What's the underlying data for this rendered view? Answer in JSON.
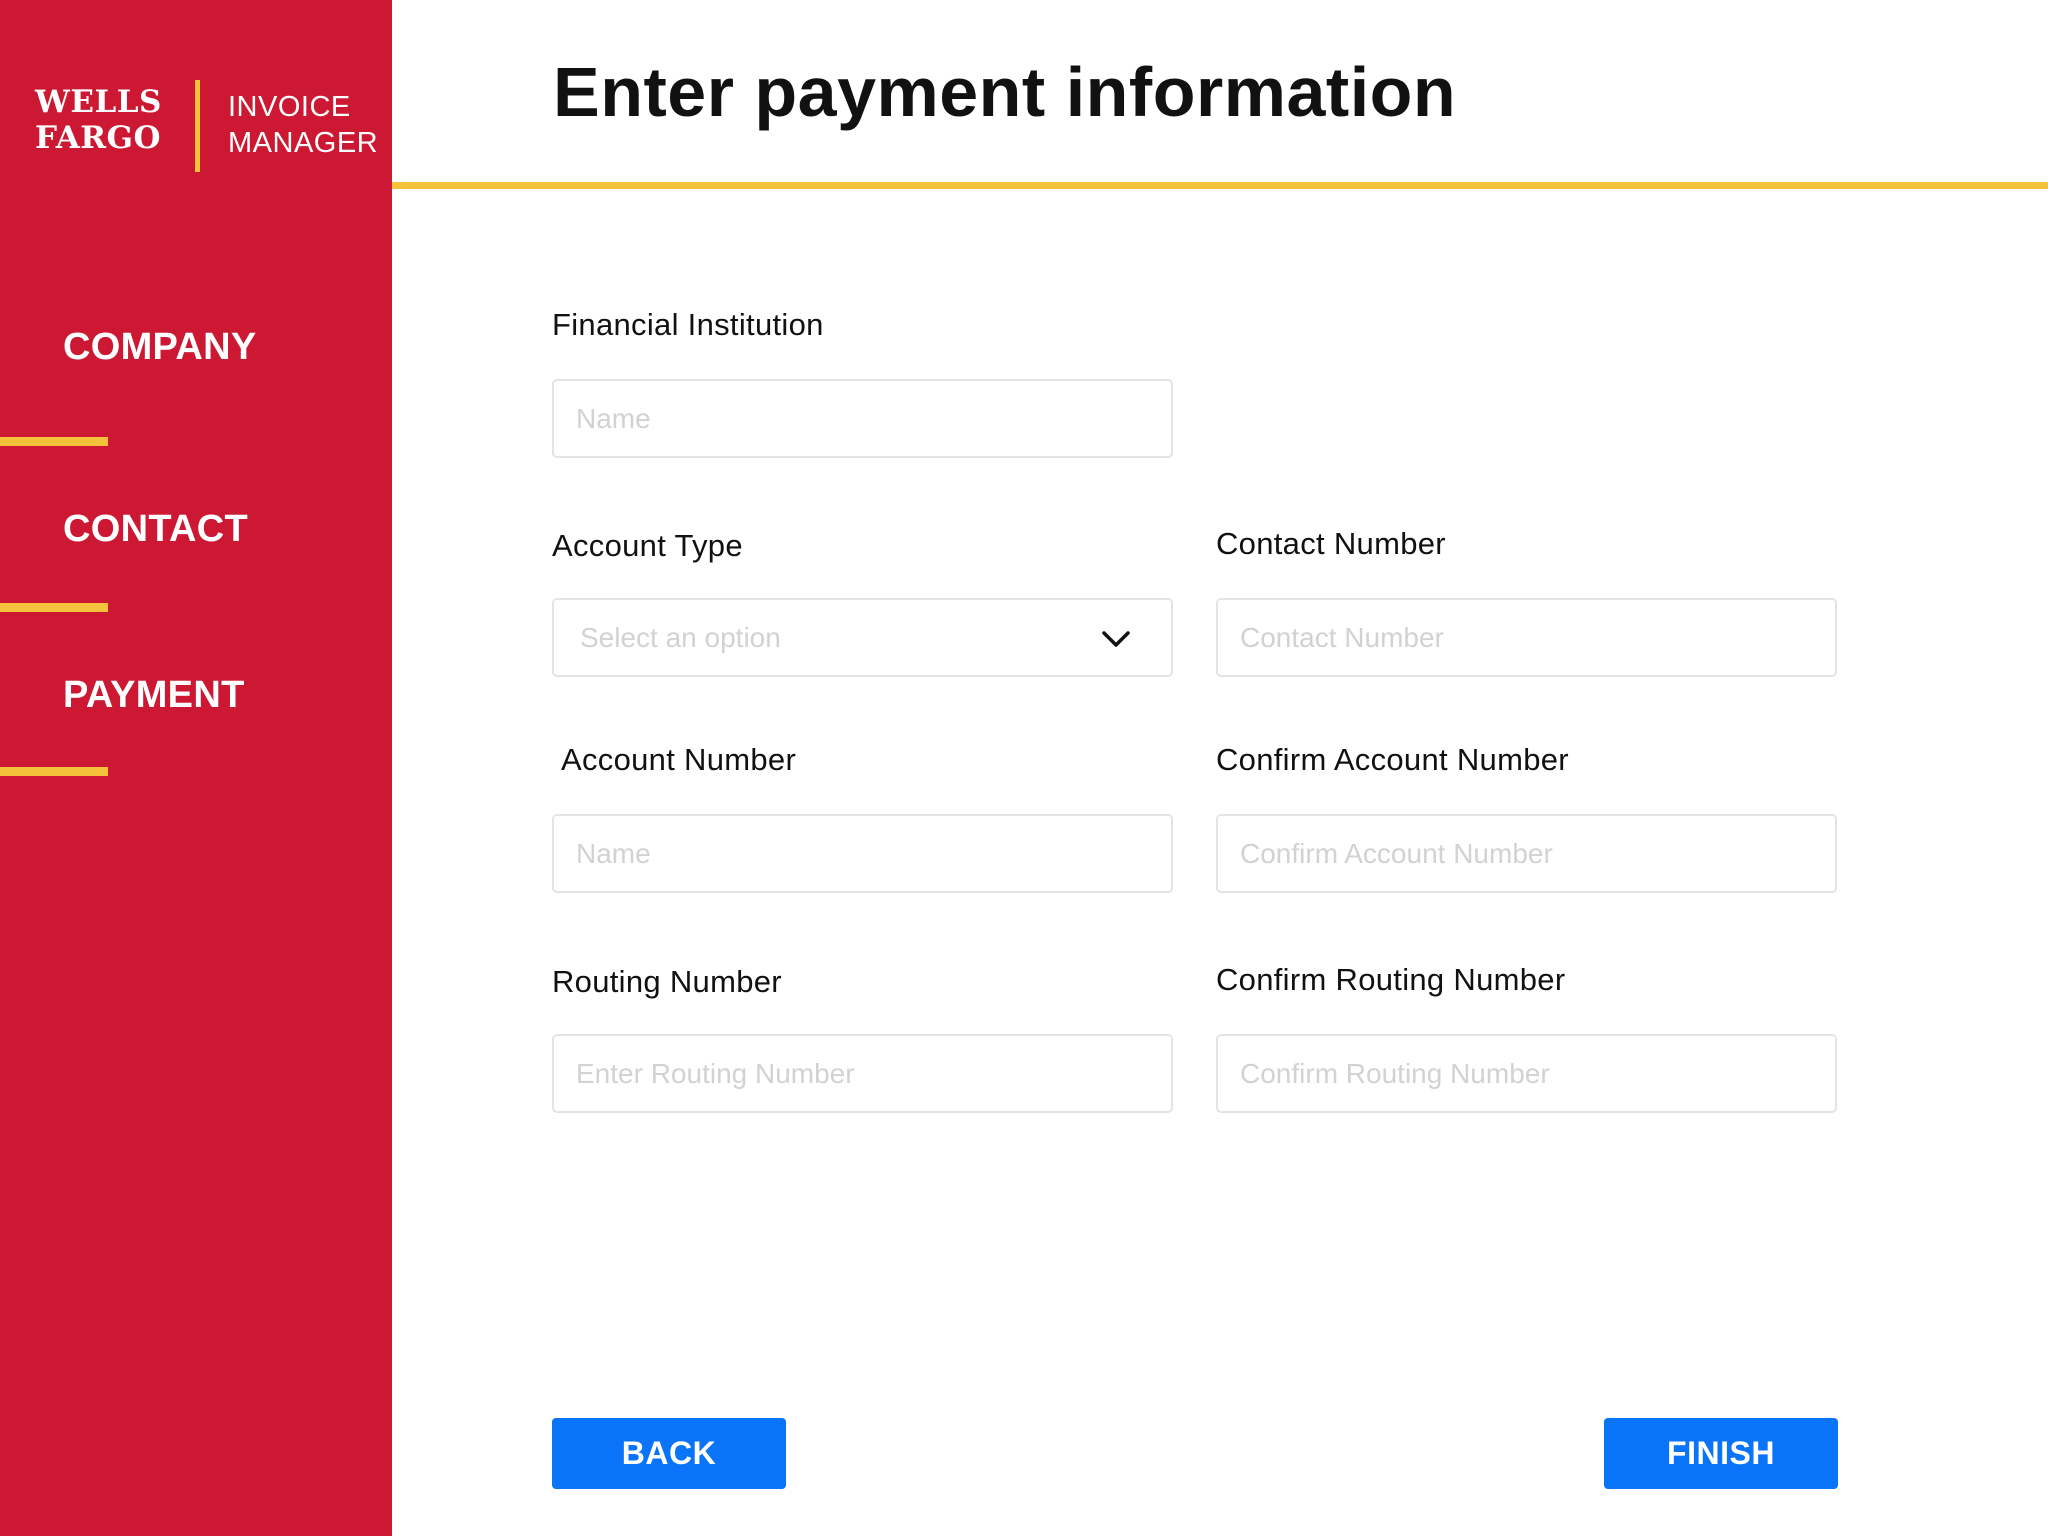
{
  "brand": {
    "line1": "WELLS",
    "line2": "FARGO",
    "product_line1": "INVOICE",
    "product_line2": "MANAGER"
  },
  "sidebar": {
    "items": [
      {
        "label": "COMPANY"
      },
      {
        "label": "CONTACT"
      },
      {
        "label": "PAYMENT"
      }
    ]
  },
  "header": {
    "title": "Enter payment information"
  },
  "form": {
    "financial_institution": {
      "label": "Financial Institution",
      "placeholder": "Name",
      "value": ""
    },
    "account_type": {
      "label": "Account Type",
      "placeholder": "Select an option",
      "value": ""
    },
    "contact_number": {
      "label": "Contact Number",
      "placeholder": "Contact Number",
      "value": ""
    },
    "account_number": {
      "label": "Account Number",
      "placeholder": "Name",
      "value": ""
    },
    "confirm_account_number": {
      "label": "Confirm Account Number",
      "placeholder": "Confirm Account Number",
      "value": ""
    },
    "routing_number": {
      "label": "Routing Number",
      "placeholder": "Enter Routing Number",
      "value": ""
    },
    "confirm_routing_number": {
      "label": "Confirm Routing Number",
      "placeholder": "Confirm Routing Number",
      "value": ""
    }
  },
  "actions": {
    "back_label": "BACK",
    "finish_label": "FINISH"
  },
  "colors": {
    "sidebar_bg": "#cc1832",
    "accent_yellow": "#f5c33b",
    "button_blue": "#0a74f9"
  },
  "icons": {
    "select_chevron": "chevron-down-icon"
  }
}
